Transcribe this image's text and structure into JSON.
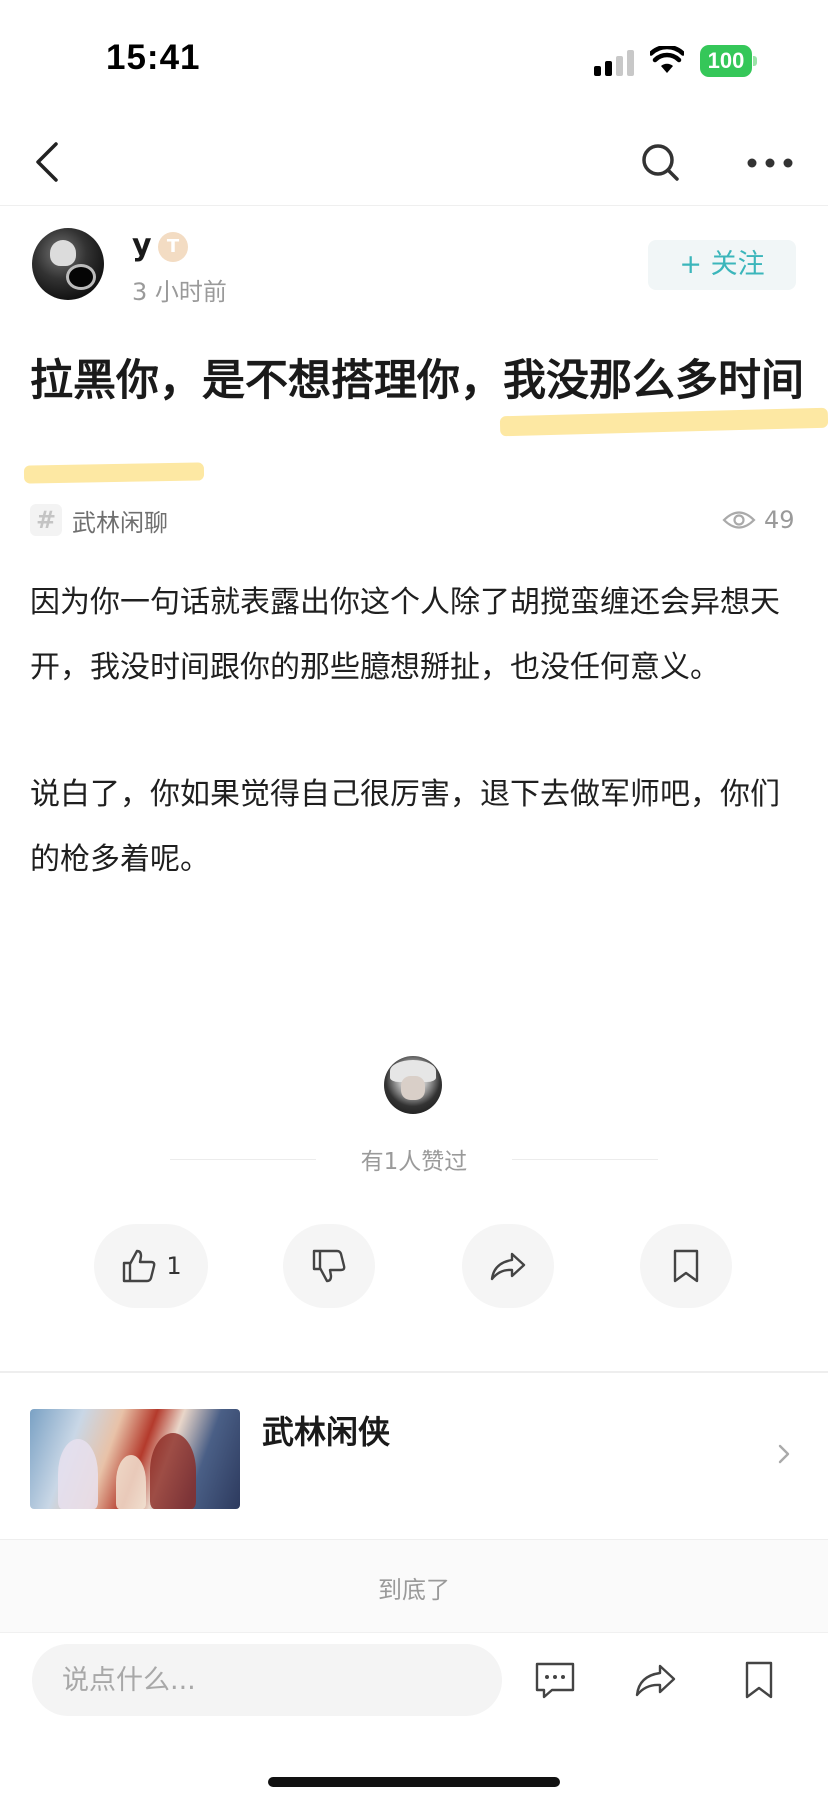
{
  "status_bar": {
    "time": "15:41",
    "battery": "100"
  },
  "author": {
    "name": "y",
    "badge": "T",
    "time": "3 小时前",
    "follow_label": "+ 关注"
  },
  "post": {
    "title": "拉黑你，是不想搭理你，我没那么多时间",
    "topic": "武林闲聊",
    "views": "49",
    "paragraphs": [
      "因为你一句话就表露出你这个人除了胡搅蛮缠还会异想天开，我没时间跟你的那些臆想掰扯，也没任何意义。",
      "说白了，你如果觉得自己很厉害，退下去做军师吧，你们的枪多着呢。"
    ]
  },
  "likes": {
    "text": "有1人赞过",
    "like_count": "1"
  },
  "game": {
    "name": "武林闲侠"
  },
  "end_text": "到底了",
  "comment": {
    "placeholder": "说点什么..."
  },
  "icons": {
    "back": "chevron-left-icon",
    "search": "search-icon",
    "more": "more-dots-icon",
    "topic": "hash-icon",
    "views": "eye-icon",
    "like": "thumbs-up-icon",
    "dislike": "thumbs-down-icon",
    "share": "share-icon",
    "collect": "bookmark-icon",
    "comment": "comment-icon"
  },
  "colors": {
    "accent": "#3bb6bb",
    "highlight": "#fde8a3",
    "battery": "#35c759"
  }
}
